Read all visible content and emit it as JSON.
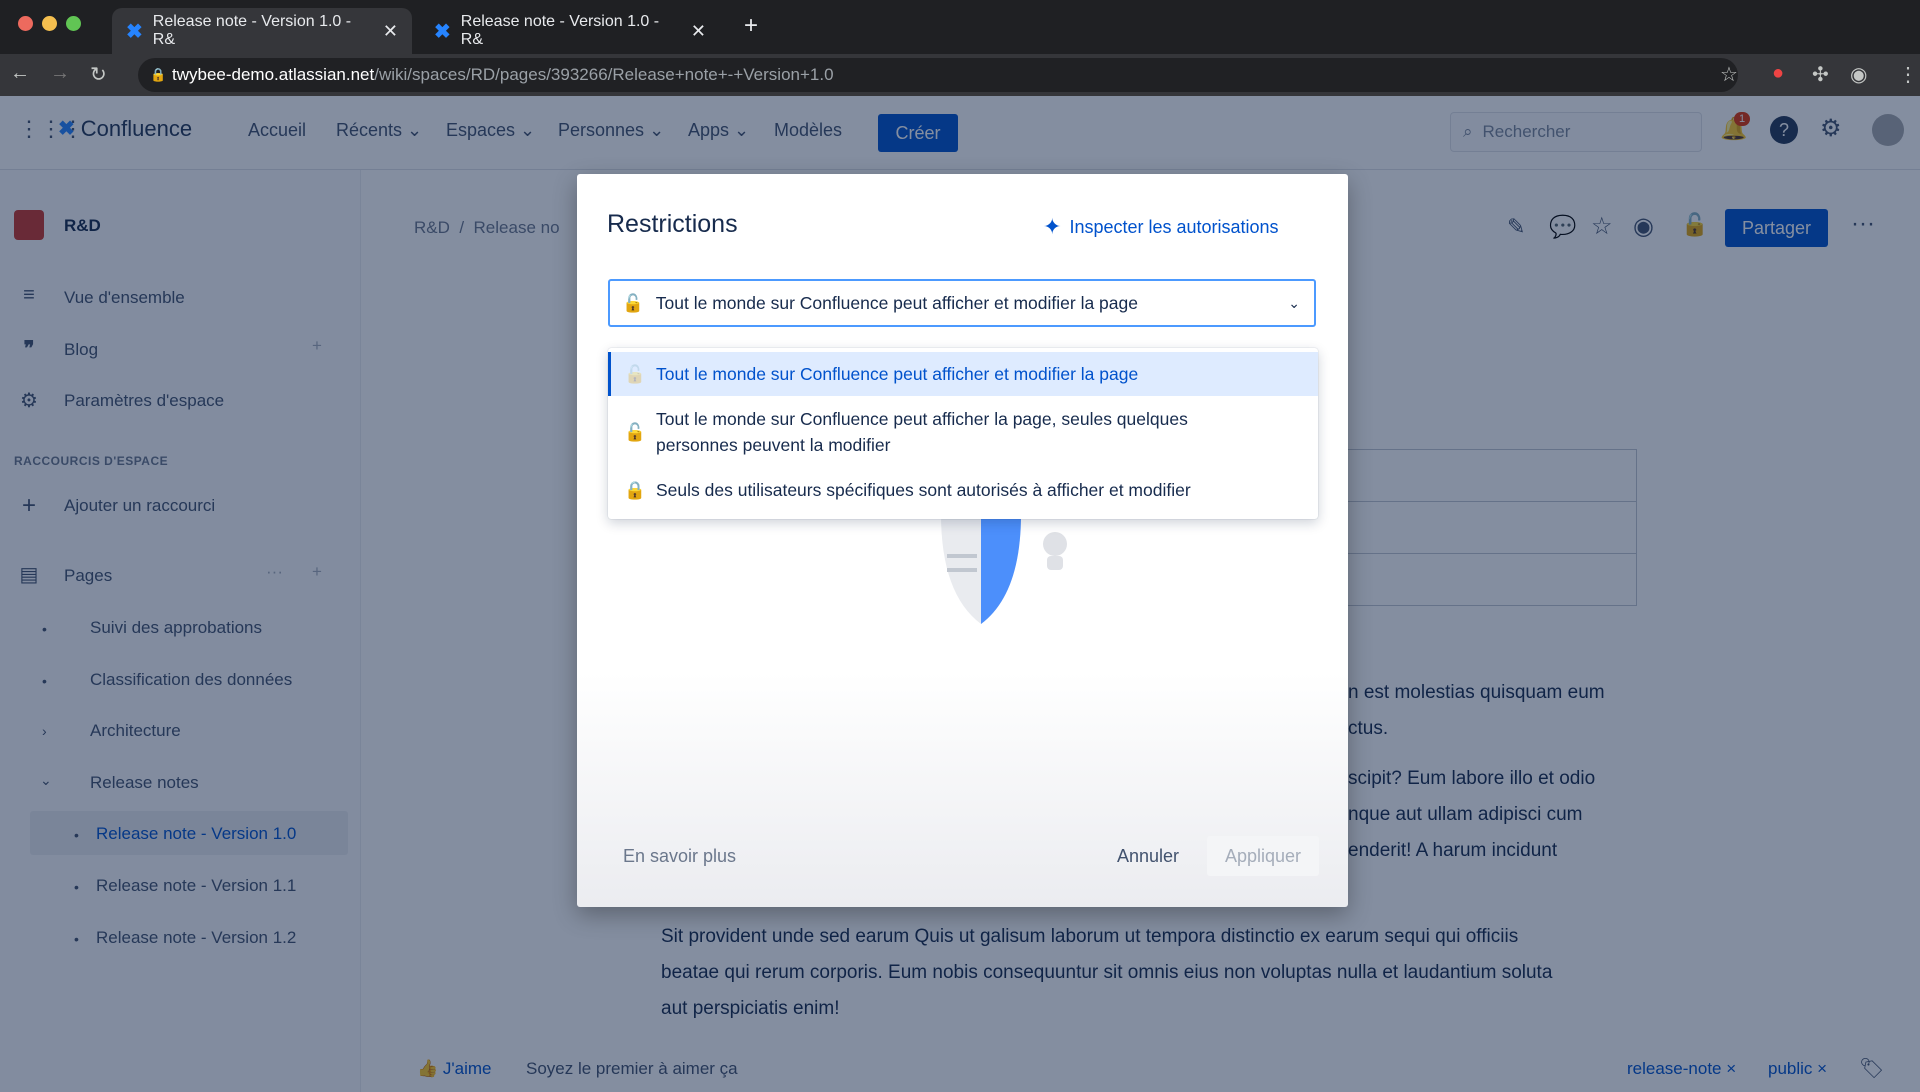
{
  "browser": {
    "tabs": [
      {
        "title": "Release note - Version 1.0 - R&",
        "active": true
      },
      {
        "title": "Release note - Version 1.0 - R&",
        "active": false
      }
    ],
    "url_host": "twybee-demo.atlassian.net",
    "url_path": "/wiki/spaces/RD/pages/393266/Release+note+-+Version+1.0"
  },
  "nav": {
    "product": "Confluence",
    "items": [
      "Accueil",
      "Récents",
      "Espaces",
      "Personnes",
      "Apps",
      "Modèles"
    ],
    "create": "Créer",
    "search_placeholder": "Rechercher",
    "notification_count": "1"
  },
  "sidebar": {
    "space": "R&D",
    "items": [
      "Vue d'ensemble",
      "Blog",
      "Paramètres d'espace"
    ],
    "shortcuts_heading": "RACCOURCIS D'ESPACE",
    "add_shortcut": "Ajouter un raccourci",
    "pages_label": "Pages",
    "tree": [
      "Suivi des approbations",
      "Classification des données",
      "Architecture",
      "Release notes"
    ],
    "children": [
      "Release note - Version 1.0",
      "Release note - Version 1.1",
      "Release note - Version 1.2"
    ]
  },
  "page": {
    "breadcrumb": [
      "R&D",
      "Release no"
    ],
    "share": "Partager",
    "fragments": [
      "n est molestias quisquam eum",
      "ctus.",
      "scipit? Eum labore illo et odio",
      "nque aut ullam adipisci cum",
      "enderit! A harum incidunt"
    ],
    "paragraph": [
      "Sit provident unde sed earum Quis ut galisum laborum ut tempora distinctio ex earum sequi qui officiis",
      "beatae qui rerum corporis. Eum nobis consequuntur sit omnis eius non voluptas nulla et laudantium soluta",
      "aut perspiciatis enim!"
    ],
    "like": "J'aime",
    "like_hint": "Soyez le premier à aimer ça",
    "labels": [
      "release-note",
      "public"
    ]
  },
  "modal": {
    "title": "Restrictions",
    "inspect": "Inspecter les autorisations",
    "selected": "Tout le monde sur Confluence peut afficher et modifier la page",
    "options": [
      {
        "label": "Tout le monde sur Confluence peut afficher et modifier la page",
        "icon": "unlock-icon"
      },
      {
        "label": "Tout le monde sur Confluence peut afficher la page, seules quelques personnes peuvent la modifier",
        "icon": "unlock-icon"
      },
      {
        "label": "Seuls des utilisateurs spécifiques sont autorisés à afficher et modifier",
        "icon": "lock-icon"
      }
    ],
    "learn_more": "En savoir plus",
    "cancel": "Annuler",
    "apply": "Appliquer"
  },
  "colors": {
    "accent": "#0052cc",
    "lock": "#de350b"
  }
}
